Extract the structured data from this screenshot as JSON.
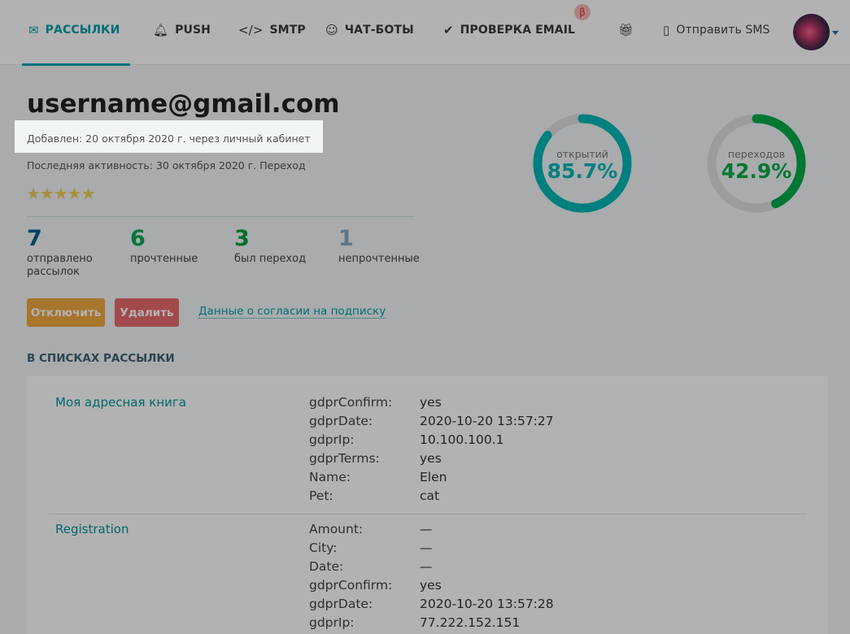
{
  "nav": {
    "tabs": [
      {
        "label": "РАССЫЛКИ",
        "icon": "envelope-icon"
      },
      {
        "label": "PUSH",
        "icon": "bell-icon"
      },
      {
        "label": "SMTP",
        "icon": "code-icon"
      },
      {
        "label": "ЧАТ-БОТЫ",
        "icon": "chat-icon"
      },
      {
        "label": "ПРОВЕРКА EMAIL",
        "icon": "check-circle-icon"
      }
    ],
    "beta": "β",
    "sms": "Отправить SMS"
  },
  "contact": {
    "email": "username@gmail.com",
    "added": "Добавлен: 20 октября 2020 г. через личный кабинет",
    "last_activity": "Последняя активность: 30 октября 2020 г. Переход",
    "rating": 5
  },
  "stats": [
    {
      "value": "7",
      "label": "отправлено рассылок",
      "color": "#005f87"
    },
    {
      "value": "6",
      "label": "прочтенные",
      "color": "#00a85a"
    },
    {
      "value": "3",
      "label": "был переход",
      "color": "#00a040"
    },
    {
      "value": "1",
      "label": "непрочтенные",
      "color": "#8aa8b8"
    }
  ],
  "rings": [
    {
      "label": "открытий",
      "value_text": "85.7%",
      "percent": 85.7,
      "color": "#00b7b7"
    },
    {
      "label": "переходов",
      "value_text": "42.9%",
      "percent": 42.9,
      "color": "#00ab4a"
    }
  ],
  "actions": {
    "disable": "Отключить",
    "delete": "Удалить",
    "consent_link": "Данные о согласии на подписку"
  },
  "lists_title": "В СПИСКАХ РАССЫЛКИ",
  "lists": [
    {
      "name": "Моя адресная книга",
      "fields": [
        [
          "gdprConfirm:",
          "yes"
        ],
        [
          "gdprDate:",
          "2020-10-20 13:57:27"
        ],
        [
          "gdprIp:",
          "10.100.100.1"
        ],
        [
          "gdprTerms:",
          "yes"
        ],
        [
          "Name:",
          "Elen"
        ],
        [
          "Pet:",
          "cat"
        ]
      ]
    },
    {
      "name": "Registration",
      "fields": [
        [
          "Amount:",
          "—"
        ],
        [
          "City:",
          "—"
        ],
        [
          "Date:",
          "—"
        ],
        [
          "gdprConfirm:",
          "yes"
        ],
        [
          "gdprDate:",
          "2020-10-20 13:57:28"
        ],
        [
          "gdprIp:",
          "77.222.152.151"
        ]
      ]
    }
  ]
}
